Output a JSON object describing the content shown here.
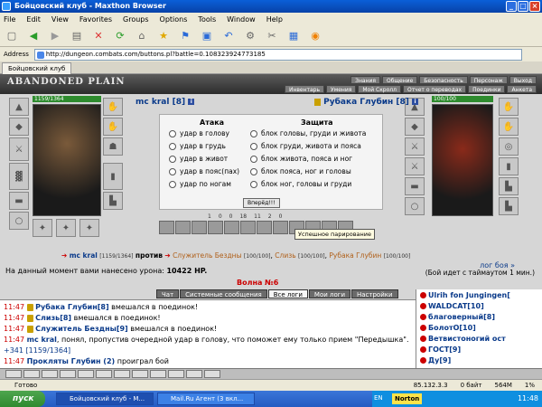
{
  "window": {
    "title": "Бойцовский клуб - Maxthon Browser"
  },
  "menu": [
    "File",
    "Edit",
    "View",
    "Favorites",
    "Groups",
    "Options",
    "Tools",
    "Window",
    "Help"
  ],
  "address": {
    "label": "Address",
    "url": "http://dungeon.combats.com/buttons.pl?battle=0.108323924773185"
  },
  "tab": {
    "label": "Бойцовский клуб"
  },
  "game": {
    "logo": "ABANDONED PLAIN",
    "nav_top": [
      "Знания",
      "Общение",
      "Безопасность",
      "Персонаж",
      "Выход"
    ],
    "nav_bottom": [
      "Инвентарь",
      "Умения",
      "Мой Скролл",
      "Отчет о переводах",
      "Поединки",
      "Анкета"
    ],
    "left_player": {
      "name": "mc kral",
      "level": "[8]",
      "hp": "1159/1364"
    },
    "right_player": {
      "name": "Рубака Глубин",
      "level": "[8]",
      "hp": "100/100"
    },
    "attack_title": "Атака",
    "defense_title": "Защита",
    "attacks": [
      "удар в голову",
      "удар в грудь",
      "удар в живот",
      "удар в пояс(пах)",
      "удар по ногам"
    ],
    "defenses": [
      "блок головы, груди и живота",
      "блок груди, живота и пояса",
      "блок живота, пояса и ног",
      "блок пояса, ног и головы",
      "блок ног, головы и груди"
    ],
    "go_button": "Вперёд!!!",
    "counters": [
      "1",
      "0",
      "0",
      "18",
      "11",
      "2",
      "0"
    ],
    "tooltip": "Успешное парирование",
    "vs": {
      "left_name": "mc kral",
      "left_hp": "[1159/1364]",
      "word": "против",
      "e1": "Служитель Бездны",
      "e1_hp": "[100/100]",
      "e2": "Слизь",
      "e2_hp": "[100/100]",
      "e3": "Рубака Глубин",
      "e3_hp": "[100/100]"
    },
    "battle_log_link": "лог боя »",
    "damage_label": "На данный момент вами нанесено урона:",
    "damage_value": "10422 HP.",
    "timeout": "(Бой идет с таймаутом 1 мин.)",
    "wave": "Волна №6"
  },
  "chat_tabs": [
    "Чат",
    "Системные сообщения",
    "Все логи",
    "Мои логи",
    "Настройки"
  ],
  "chat_active_index": 2,
  "chat": [
    {
      "time": "11:47",
      "name": "Рубака Глубин",
      "level": "[8]",
      "text": "вмешался в поединок!"
    },
    {
      "time": "11:47",
      "name": "Слизь",
      "level": "[8]",
      "text": "вмешался в поединок!"
    },
    {
      "time": "11:47",
      "name": "Служитель Бездны",
      "level": "[9]",
      "text": "вмешался в поединок!"
    },
    {
      "time": "11:47",
      "name": "mc kral",
      "level": "",
      "text": ", понял, пропустив очередной удар в голову, что поможет ему только прием \"Передышка\"."
    },
    {
      "time": "",
      "name": "",
      "level": "",
      "text": "+341 [1159/1364]"
    },
    {
      "time": "11:47",
      "name": "Прокляты Глубин (2)",
      "level": "",
      "text": "проиграл бой"
    }
  ],
  "players": [
    "Ulrih fon Jungingen[",
    "WALDCAT[10]",
    "благоверный[8]",
    "БолотО[10]",
    "Ветвистоногий ост",
    "ГОСТ[9]",
    "Ду[9]"
  ],
  "status": {
    "left": "Готово",
    "ip": "85.132.3.3",
    "zero": "0 байт",
    "mem": "564M",
    "pct": "1%"
  },
  "taskbar": {
    "start": "пуск",
    "tasks": [
      "Бойцовский клуб - M...",
      "Mail.Ru Агент (3 вкл..."
    ],
    "lang": "EN",
    "norton": "Norton",
    "clock": "11:48"
  }
}
